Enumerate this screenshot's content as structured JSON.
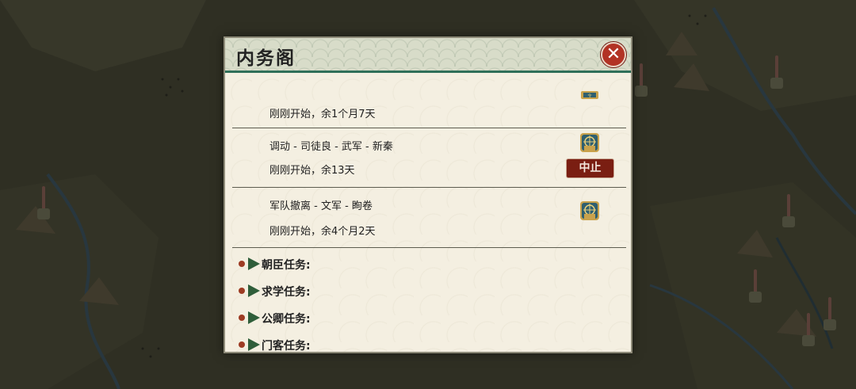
{
  "dialog": {
    "title": "内务阁",
    "close_label": "✕"
  },
  "tasks": [
    {
      "title": "",
      "progress_text": "刚刚开始，余1个月7天",
      "icon": "task-seal-icon",
      "has_stop": false
    },
    {
      "title": "调动 - 司徒良 - 武军 - 新秦",
      "progress_text": "刚刚开始，余13天",
      "icon": "task-seal-icon",
      "has_stop": true,
      "stop_label": "中止"
    },
    {
      "title": "军队撤离 - 文军 - 眴卷",
      "progress_text": "刚刚开始，余4个月2天",
      "icon": "task-seal-icon",
      "has_stop": false
    }
  ],
  "categories": [
    {
      "label": "朝臣任务:"
    },
    {
      "label": "求学任务:"
    },
    {
      "label": "公卿任务:"
    },
    {
      "label": "门客任务:"
    }
  ],
  "colors": {
    "header_bg": "#d8dcc9",
    "header_line": "#2f6f59",
    "panel_bg": "#f4efe1",
    "close_red": "#b23325",
    "stop_red": "#7a1e12",
    "arrow_green": "#2f5e3a"
  }
}
